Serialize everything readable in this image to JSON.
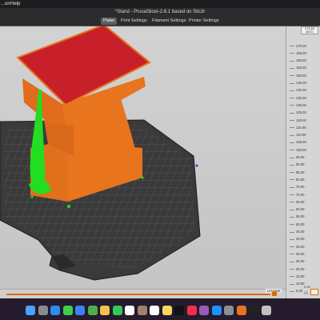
{
  "menubar": {
    "item_left": "...on",
    "item_help": "Help"
  },
  "window": {
    "title": "*Stand - PrusaSlicer-2.6.1 based on Slic3r"
  },
  "tabs": [
    {
      "label": "Plater",
      "active": true
    },
    {
      "label": "Print Settings",
      "active": false
    },
    {
      "label": "Filament Settings",
      "active": false
    },
    {
      "label": "Printer Settings",
      "active": false
    }
  ],
  "layer_slider": {
    "top_value": "174.60",
    "top_layer": "(872)",
    "ticks": [
      "174.60",
      "170.00",
      "165.00",
      "160.00",
      "155.00",
      "150.00",
      "145.00",
      "140.00",
      "135.00",
      "130.00",
      "125.00",
      "120.00",
      "115.00",
      "110.00",
      "105.00",
      "100.00",
      "95.00",
      "90.00",
      "85.00",
      "80.00",
      "75.00",
      "70.00",
      "65.00",
      "60.00",
      "55.00",
      "50.00",
      "45.00",
      "40.00",
      "35.00",
      "30.00",
      "25.00",
      "20.00",
      "15.00",
      "10.00",
      "5.00",
      "0.20"
    ],
    "bottom_value": "0.20",
    "bottom_layer": "(1)"
  },
  "move_slider": {
    "value": "1223268"
  },
  "colors": {
    "model_orange": "#e8741e",
    "model_top_red": "#c8202a",
    "support_green": "#22dd22",
    "accent_orange": "#e06a00",
    "bed_dark": "#3a3a3a"
  },
  "dock": {
    "icons": [
      "finder-icon",
      "launchpad-icon",
      "safari-icon",
      "messages-icon",
      "mail-icon",
      "maps-icon",
      "photos-icon",
      "facetime-icon",
      "calendar-icon",
      "contacts-icon",
      "reminders-icon",
      "notes-icon",
      "tv-icon",
      "music-icon",
      "podcasts-icon",
      "appstore-icon",
      "settings-icon",
      "prusaslicer-icon",
      "terminal-icon",
      "trash-icon"
    ]
  }
}
